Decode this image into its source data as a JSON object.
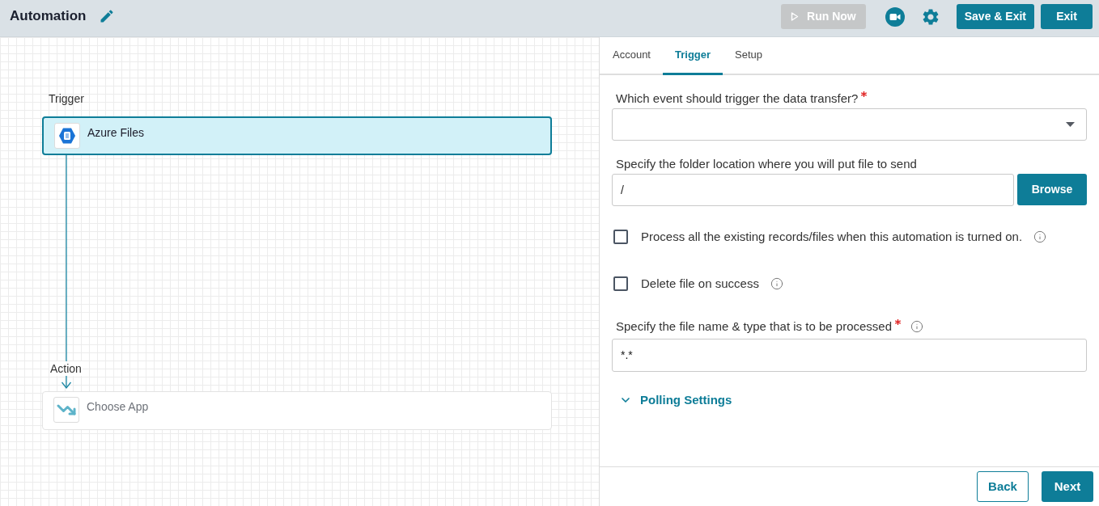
{
  "header": {
    "title": "Automation",
    "actions": [
      {
        "kind": "run",
        "label": "Run Now",
        "disabled": true
      },
      {
        "kind": "video"
      },
      {
        "kind": "settings"
      },
      {
        "kind": "button",
        "label": "Save & Exit",
        "disabled": false
      },
      {
        "kind": "button",
        "label": "Exit",
        "disabled": false
      }
    ]
  },
  "canvas": {
    "steps": [
      {
        "kind": "trigger",
        "heading": "Trigger",
        "app": "Azure Files",
        "selected": true
      },
      {
        "kind": "action",
        "heading": "Action",
        "app": "Choose App",
        "selected": false
      }
    ]
  },
  "panel": {
    "tabs": [
      {
        "label": "Account",
        "selected": false
      },
      {
        "label": "Trigger",
        "selected": true
      },
      {
        "label": "Setup",
        "selected": false
      }
    ],
    "fields": [
      {
        "kind": "select",
        "label": "Which event should trigger the data transfer?",
        "required": true,
        "info": false
      },
      {
        "kind": "input_button",
        "label": "Specify the folder location where you will put file to send",
        "required": false,
        "info": false,
        "value": "/",
        "button": "Browse"
      },
      {
        "kind": "checkbox",
        "label": "Process all the existing records/files when this automation is turned on.",
        "checked": false,
        "info": true
      },
      {
        "kind": "checkbox",
        "label": "Delete file on success",
        "checked": false,
        "info": true
      },
      {
        "kind": "input",
        "label": "Specify the file name & type that is to be processed",
        "required": true,
        "info": true,
        "value": "*.*"
      }
    ],
    "polling": {
      "label": "Polling Settings",
      "expanded": false
    },
    "footer": {
      "buttons": [
        {
          "kind": "secondary",
          "label": "Back"
        },
        {
          "kind": "primary",
          "label": "Next"
        }
      ]
    }
  }
}
